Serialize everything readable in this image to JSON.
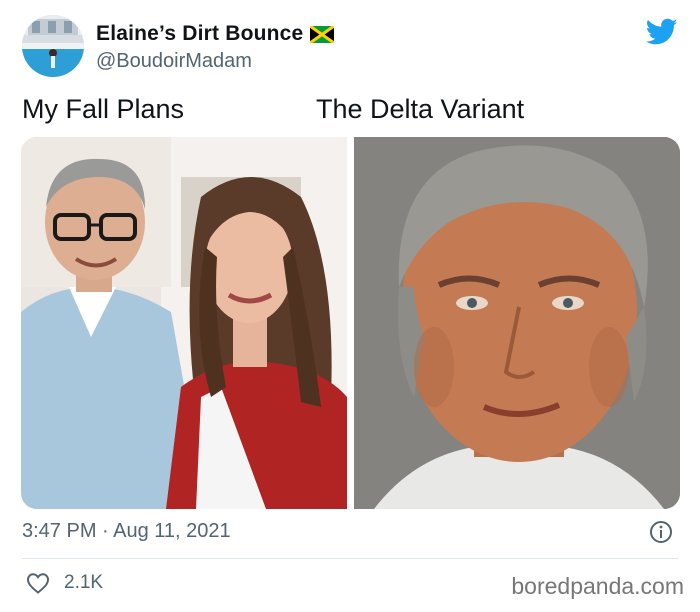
{
  "tweet": {
    "display_name": "Elaine’s Dirt Bounce",
    "handle": "@BoudoirMadam",
    "flag_icon": "jamaica-flag-icon",
    "platform_icon": "twitter-bird-icon",
    "captions": {
      "left": "My Fall Plans",
      "right": "The Delta Variant"
    },
    "timestamp": "3:47 PM · Aug 11, 2021",
    "likes": "2.1K",
    "like_icon": "heart-icon",
    "info_icon": "info-icon"
  },
  "watermark": "boredpanda.com",
  "colors": {
    "accent": "#1da1f2",
    "secondary_text": "#536471",
    "divider": "#e1e8ed"
  }
}
